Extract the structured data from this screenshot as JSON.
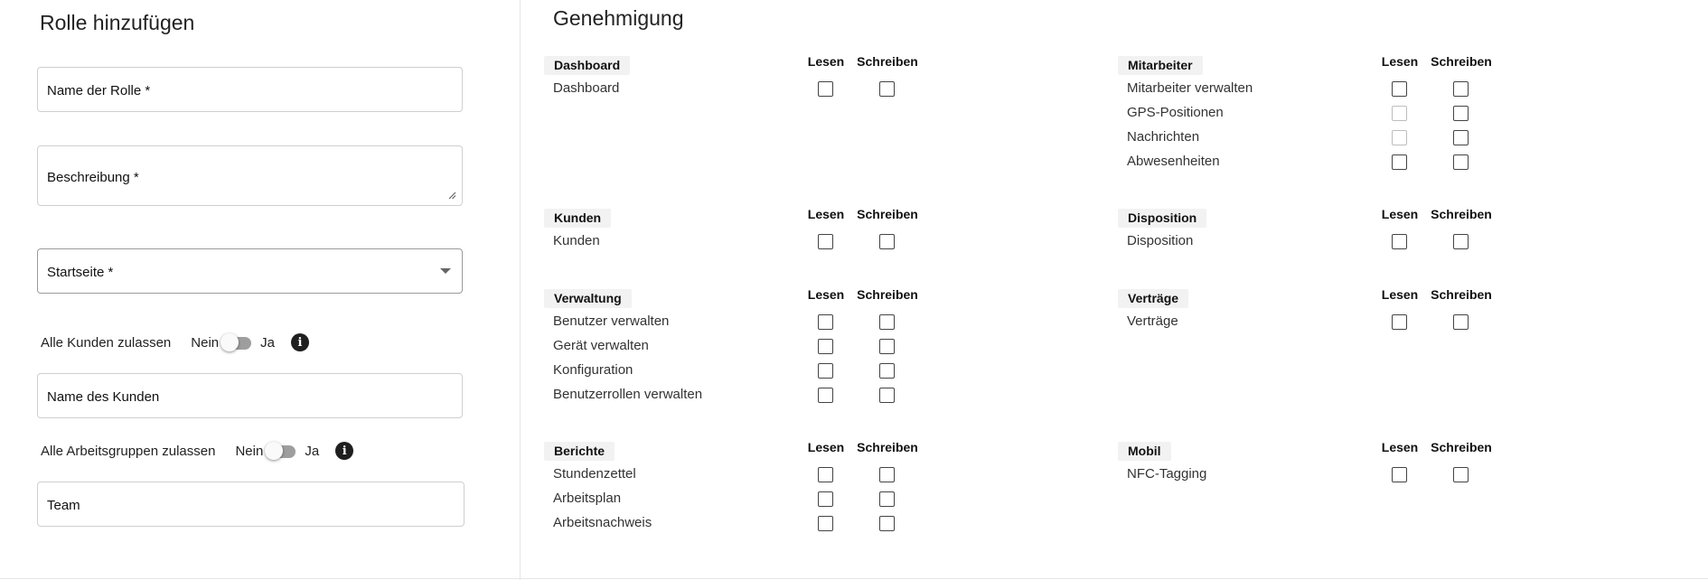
{
  "form": {
    "title": "Rolle hinzufügen",
    "role_name_label": "Name der Rolle *",
    "description_label": "Beschreibung *",
    "start_page_label": "Startseite *",
    "all_customers": {
      "label": "Alle Kunden zulassen",
      "off": "Nein",
      "on": "Ja",
      "value": false
    },
    "customer_name_label": "Name des Kunden",
    "all_workgroups": {
      "label": "Alle Arbeitsgruppen zulassen",
      "off": "Nein",
      "on": "Ja",
      "value": false
    },
    "team_label": "Team"
  },
  "permissions": {
    "title": "Genehmigung",
    "read_label": "Lesen",
    "write_label": "Schreiben",
    "groups": [
      {
        "name": "Dashboard",
        "rows": [
          {
            "name": "Dashboard",
            "read_disabled": false
          }
        ]
      },
      {
        "name": "Mitarbeiter",
        "rows": [
          {
            "name": "Mitarbeiter verwalten",
            "read_disabled": false
          },
          {
            "name": "GPS-Positionen",
            "read_disabled": true
          },
          {
            "name": "Nachrichten",
            "read_disabled": true
          },
          {
            "name": "Abwesenheiten",
            "read_disabled": false
          }
        ]
      },
      {
        "name": "Kunden",
        "rows": [
          {
            "name": "Kunden",
            "read_disabled": false
          }
        ]
      },
      {
        "name": "Disposition",
        "rows": [
          {
            "name": "Disposition",
            "read_disabled": false
          }
        ]
      },
      {
        "name": "Verwaltung",
        "rows": [
          {
            "name": "Benutzer verwalten",
            "read_disabled": false
          },
          {
            "name": "Gerät verwalten",
            "read_disabled": false
          },
          {
            "name": "Konfiguration",
            "read_disabled": false
          },
          {
            "name": "Benutzerrollen verwalten",
            "read_disabled": false
          }
        ]
      },
      {
        "name": "Verträge",
        "rows": [
          {
            "name": "Verträge",
            "read_disabled": false
          }
        ]
      },
      {
        "name": "Berichte",
        "rows": [
          {
            "name": "Stundenzettel",
            "read_disabled": false
          },
          {
            "name": "Arbeitsplan",
            "read_disabled": false
          },
          {
            "name": "Arbeitsnachweis",
            "read_disabled": false
          }
        ]
      },
      {
        "name": "Mobil",
        "rows": [
          {
            "name": "NFC-Tagging",
            "read_disabled": false
          }
        ]
      }
    ]
  }
}
